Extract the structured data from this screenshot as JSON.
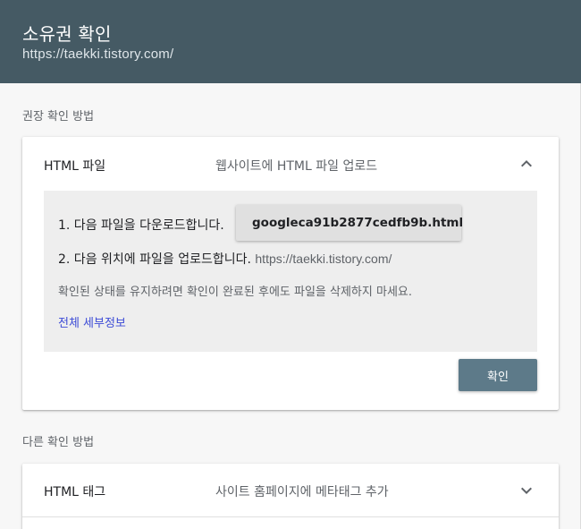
{
  "header": {
    "title": "소유권 확인",
    "site_url": "https://taekki.tistory.com/"
  },
  "recommended_section": {
    "label": "권장 확인 방법",
    "card": {
      "method_title": "HTML 파일",
      "method_desc": "웹사이트에 HTML 파일 업로드",
      "expanded": true,
      "step1_text": "1. 다음 파일을 다운로드합니다.",
      "download_filename": "googleca91b2877cedfb9b.html",
      "step2_text": "2. 다음 위치에 파일을 업로드합니다.",
      "step2_url": "https://taekki.tistory.com/",
      "note": "확인된 상태를 유지하려면 확인이 완료된 후에도 파일을 삭제하지 마세요.",
      "details_link": "전체 세부정보",
      "confirm_label": "확인"
    }
  },
  "other_section": {
    "label": "다른 확인 방법",
    "card": {
      "method_title": "HTML 태그",
      "method_desc": "사이트 홈페이지에 메타태그 추가",
      "expanded": false
    }
  },
  "icons": {
    "expand_less": "chevron-up-icon",
    "expand_more": "chevron-down-icon",
    "download": "download-icon"
  },
  "colors": {
    "header_bg": "#455a64",
    "confirm_bg": "#5d7a89",
    "link": "#3c4bd6",
    "panel_bg": "#eeeeee"
  }
}
